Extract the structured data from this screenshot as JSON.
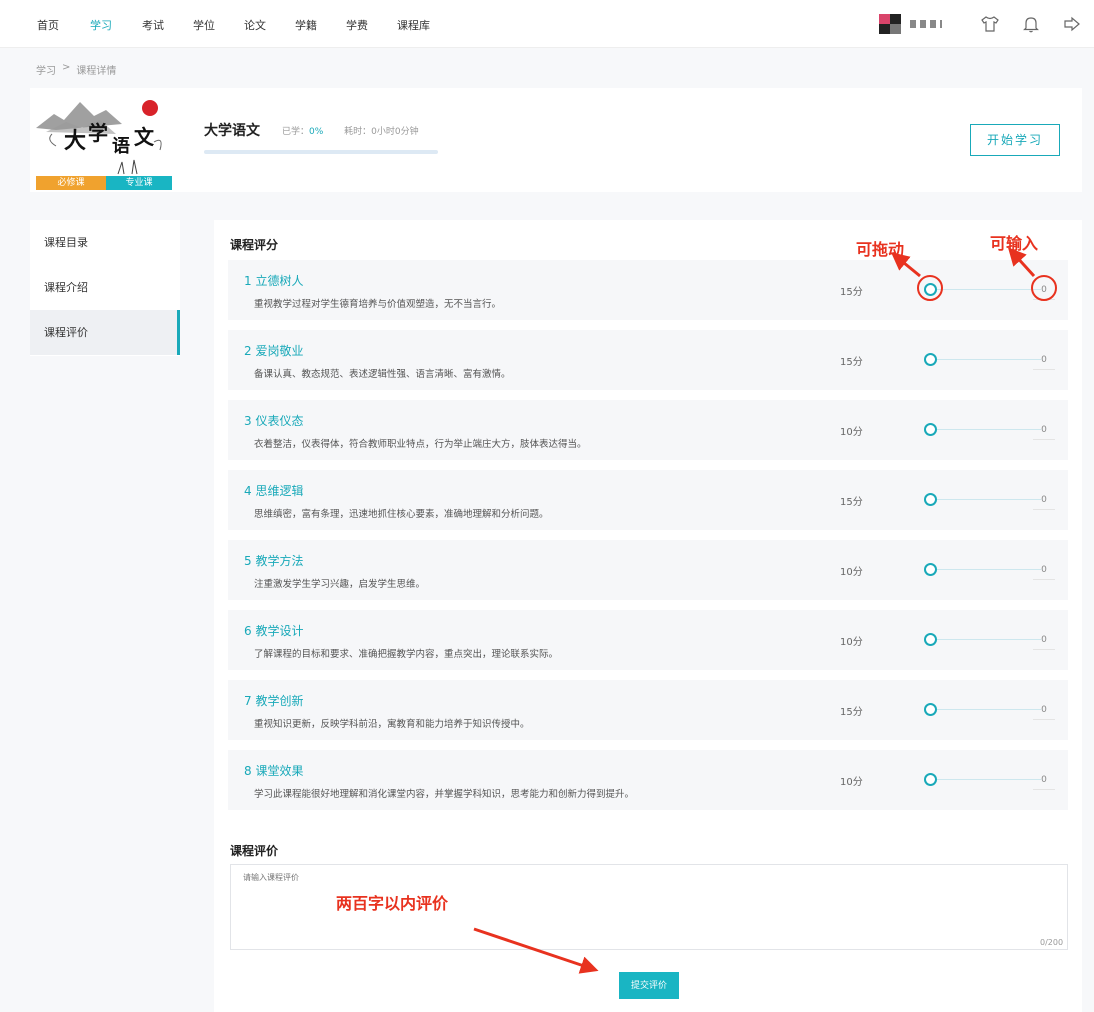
{
  "nav": {
    "items": [
      "首页",
      "学习",
      "考试",
      "学位",
      "论文",
      "学籍",
      "学费",
      "课程库"
    ],
    "active_index": 1
  },
  "header_icons": [
    "shirt-icon",
    "bell-icon",
    "logout-icon"
  ],
  "breadcrumb": [
    "学习",
    ">",
    "课程详情"
  ],
  "course": {
    "title": "大学语文",
    "learned_label": "已学：",
    "learned_value": "0%",
    "progress": 0,
    "time_label": "耗时：0小时0分钟",
    "tags": [
      "必修课",
      "专业课"
    ],
    "start_button": "开始学习"
  },
  "sidebar": {
    "items": [
      "课程目录",
      "课程介绍",
      "课程评价"
    ],
    "active_index": 2
  },
  "rating": {
    "title": "课程评分",
    "criteria": [
      {
        "name": "1 立德树人",
        "desc": "重视教学过程对学生德育培养与价值观塑造，无不当言行。",
        "score": "15分",
        "value": "0"
      },
      {
        "name": "2 爱岗敬业",
        "desc": "备课认真、教态规范、表述逻辑性强、语言清晰、富有激情。",
        "score": "15分",
        "value": "0"
      },
      {
        "name": "3 仪表仪态",
        "desc": "衣着整洁，仪表得体，符合教师职业特点，行为举止端庄大方，肢体表达得当。",
        "score": "10分",
        "value": "0"
      },
      {
        "name": "4 思维逻辑",
        "desc": "思维缜密，富有条理，迅速地抓住核心要素，准确地理解和分析问题。",
        "score": "15分",
        "value": "0"
      },
      {
        "name": "5 教学方法",
        "desc": "注重激发学生学习兴趣，启发学生思维。",
        "score": "10分",
        "value": "0"
      },
      {
        "name": "6 教学设计",
        "desc": "了解课程的目标和要求、准确把握教学内容，重点突出，理论联系实际。",
        "score": "10分",
        "value": "0"
      },
      {
        "name": "7 教学创新",
        "desc": "重视知识更新，反映学科前沿，寓教育和能力培养于知识传授中。",
        "score": "15分",
        "value": "0"
      },
      {
        "name": "8 课堂效果",
        "desc": "学习此课程能很好地理解和消化课堂内容，并掌握学科知识，思考能力和创新力得到提升。",
        "score": "10分",
        "value": "0"
      }
    ]
  },
  "review": {
    "title": "课程评价",
    "placeholder": "请输入课程评价",
    "count": "0/200",
    "submit": "提交评价"
  },
  "annotations": {
    "drag": "可拖动",
    "input": "可输入",
    "limit": "两百字以内评价",
    "color": "#e8321f"
  },
  "colors": {
    "accent": "#19a9b9",
    "tag_required": "#f0a22e",
    "tag_major": "#19b5c3"
  }
}
